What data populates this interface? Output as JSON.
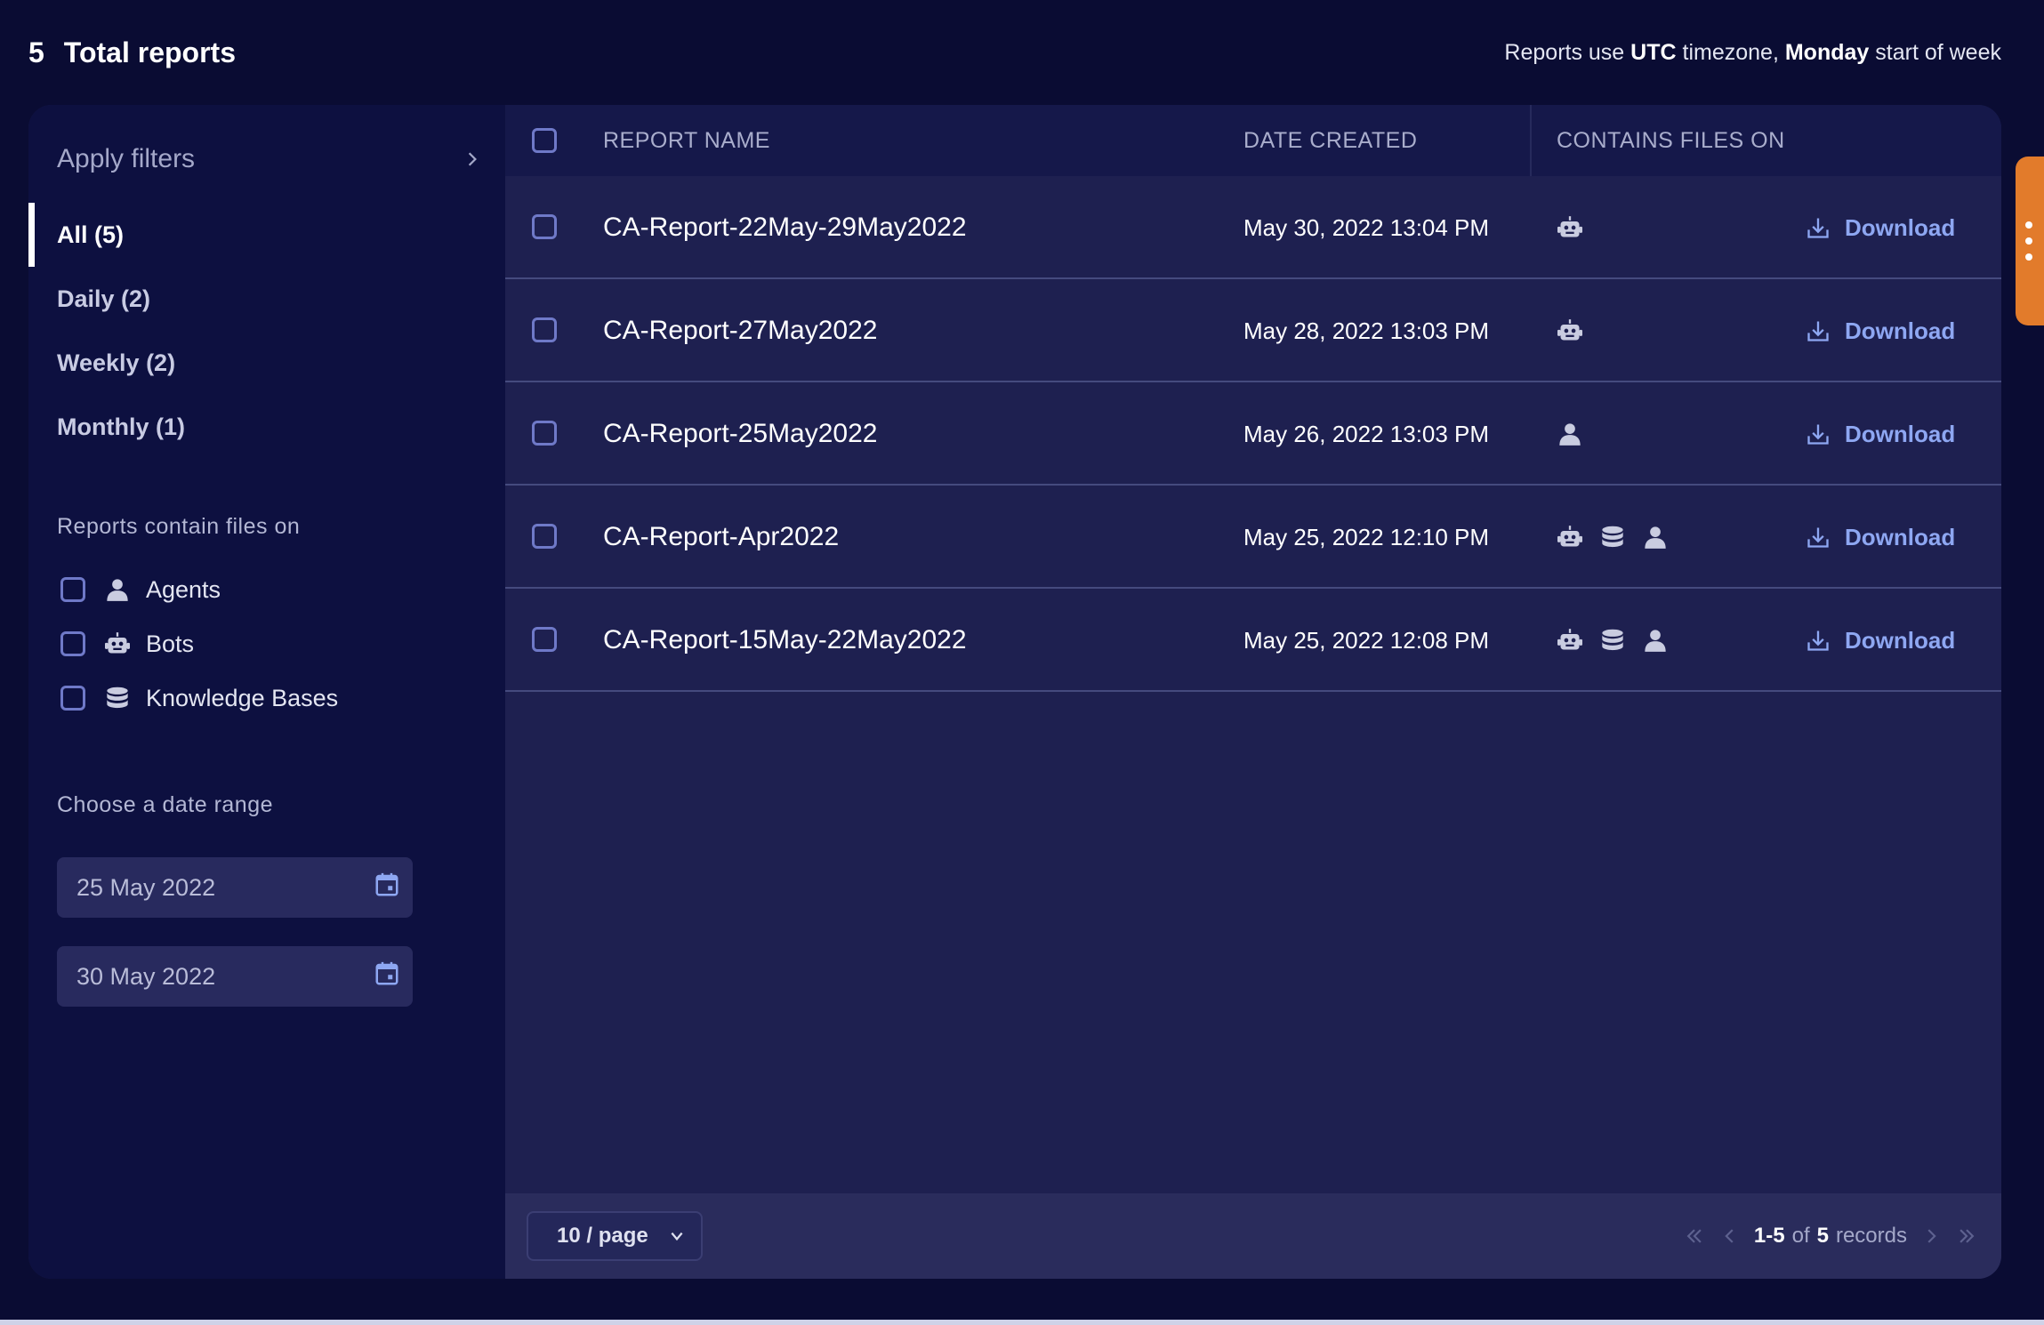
{
  "header": {
    "total_count": "5",
    "total_label": "Total reports",
    "tz_prefix": "Reports use",
    "tz_zone": "UTC",
    "tz_middle": "timezone,",
    "tz_week": "Monday",
    "tz_suffix": "start of week"
  },
  "sidebar": {
    "apply_filters": "Apply filters",
    "categories": [
      {
        "label": "All (5)",
        "active": true
      },
      {
        "label": "Daily (2)",
        "active": false
      },
      {
        "label": "Weekly (2)",
        "active": false
      },
      {
        "label": "Monthly (1)",
        "active": false
      }
    ],
    "files_section_title": "Reports contain files on",
    "file_types": [
      {
        "label": "Agents",
        "icon": "person-icon",
        "checked": false
      },
      {
        "label": "Bots",
        "icon": "robot-icon",
        "checked": false
      },
      {
        "label": "Knowledge Bases",
        "icon": "database-icon",
        "checked": false
      }
    ],
    "date_section_title": "Choose a date range",
    "date_from": "25 May 2022",
    "date_to": "30 May 2022"
  },
  "table": {
    "columns": [
      "REPORT NAME",
      "DATE CREATED",
      "CONTAINS FILES ON"
    ],
    "download_label": "Download",
    "rows": [
      {
        "name": "CA-Report-22May-29May2022",
        "date": "May 30, 2022 13:04 PM",
        "files": [
          "robot-icon"
        ]
      },
      {
        "name": "CA-Report-27May2022",
        "date": "May 28, 2022 13:03 PM",
        "files": [
          "robot-icon"
        ]
      },
      {
        "name": "CA-Report-25May2022",
        "date": "May 26, 2022 13:03 PM",
        "files": [
          "person-icon"
        ]
      },
      {
        "name": "CA-Report-Apr2022",
        "date": "May 25, 2022 12:10 PM",
        "files": [
          "robot-icon",
          "database-icon",
          "person-icon"
        ]
      },
      {
        "name": "CA-Report-15May-22May2022",
        "date": "May 25, 2022 12:08 PM",
        "files": [
          "robot-icon",
          "database-icon",
          "person-icon"
        ]
      }
    ]
  },
  "pagination": {
    "page_size": "10 / page",
    "range": "1-5",
    "of": "of",
    "total": "5",
    "records": "records"
  },
  "colors": {
    "background": "#0a0c33",
    "panel": "#1e2050",
    "sidebar": "#0d1040",
    "link": "#8ea7f2",
    "accent_tab": "#e27b2b",
    "checkbox_border": "#6f79c8"
  }
}
